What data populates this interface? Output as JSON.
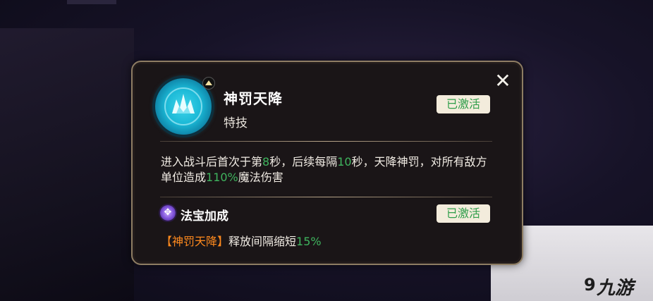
{
  "skill": {
    "name": "神罚天降",
    "type": "特技",
    "status": "已激活",
    "icon": "blue-flame-skill-icon"
  },
  "description": {
    "p1": "进入战斗后首次于第",
    "n1": "8",
    "p2": "秒，后续每隔",
    "n2": "10",
    "p3": "秒，天降神罚，对所有敌方单位造成",
    "n3": "110%",
    "p4": "魔法伤害"
  },
  "bonus": {
    "title": "法宝加成",
    "status": "已激活",
    "skill_ref": "【神罚天降】",
    "text": "释放间隔缩短",
    "value": "15%",
    "icon": "purple-treasure-icon"
  },
  "watermark": {
    "text": "九游",
    "icon": "9"
  },
  "colors": {
    "highlight_green": "#3fb45e",
    "highlight_orange": "#ff8a1e",
    "panel_border": "#8e7d63"
  }
}
